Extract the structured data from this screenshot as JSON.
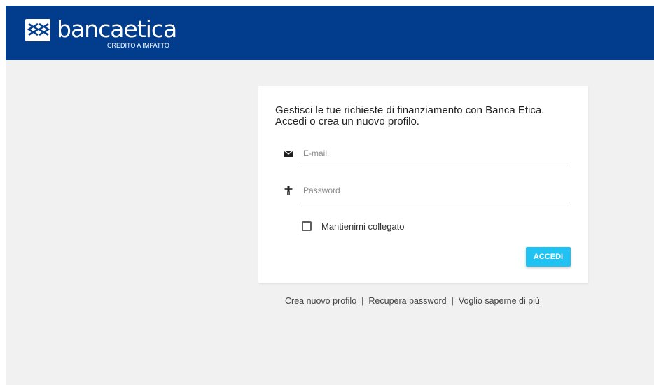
{
  "header": {
    "brand": {
      "name": "bancaetica",
      "tagline": "CREDITO A IMPATTO"
    },
    "colors": {
      "background": "#023c8c",
      "text": "#ffffff"
    }
  },
  "login_card": {
    "intro_line1": "Gestisci le tue richieste di finanziamento con Banca Etica.",
    "intro_line2": "Accedi o crea un nuovo profilo.",
    "email": {
      "placeholder": "E-mail",
      "value": "",
      "icon": "envelope-icon"
    },
    "password": {
      "placeholder": "Password",
      "value": "",
      "icon": "person-icon"
    },
    "remember_me": {
      "label": "Mantienimi collegato",
      "checked": false
    },
    "submit_label": "ACCEDI",
    "colors": {
      "accent": "#1fc2f0"
    }
  },
  "footer_links": {
    "create_profile": "Crea nuovo profilo",
    "recover_password": "Recupera password",
    "learn_more": "Voglio saperne di più",
    "separator": "|"
  }
}
